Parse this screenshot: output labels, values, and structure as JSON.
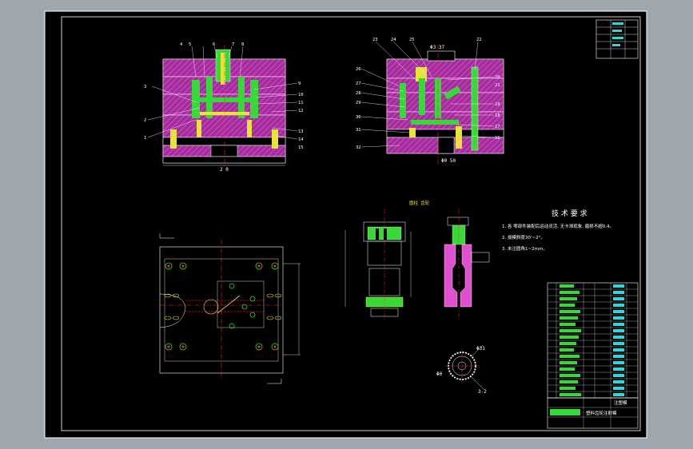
{
  "colors": {
    "background": "#9fa6ae",
    "sheet": "#000000",
    "frame": "#ffffff",
    "plate": "#b02ea6",
    "hatch": "#d04fc3",
    "part_green": "#38d838",
    "part_yellow": "#e8e23a",
    "centerline": "#ff2a2a",
    "dims": "#ffffff",
    "cyan": "#33d6d6"
  },
  "front_view": {
    "callouts": [
      "4",
      "5",
      "6",
      "7",
      "8",
      "9",
      "10",
      "11",
      "12",
      "13",
      "14",
      "15",
      "3",
      "2",
      "1"
    ],
    "width_dim": "2 0"
  },
  "side_view": {
    "callouts": [
      "23",
      "24",
      "25",
      "22",
      "26",
      "27",
      "28",
      "29",
      "30",
      "31",
      "32",
      "33",
      "19",
      "18",
      "17",
      "16",
      "20",
      "21"
    ],
    "top_dim": "Φ3 37",
    "bottom_dim": "Φ0 50"
  },
  "part_detail": {
    "label": "圆柱 齿轮"
  },
  "tech_requirements": {
    "title": "技 术 要 求",
    "lines": [
      "1. 各 零部件装配后运动灵活, 无卡滞现象, 磨损不超0.4。",
      "2. 拔模斜度30'~2°。",
      "3. 未注圆角1~2mm。"
    ]
  },
  "gear_view": {
    "dims": [
      "Φ31",
      "Φ0",
      "3-2"
    ]
  },
  "title_block": {
    "drawing_name": "塑料齿轮注射模",
    "small_text": "注塑模"
  }
}
